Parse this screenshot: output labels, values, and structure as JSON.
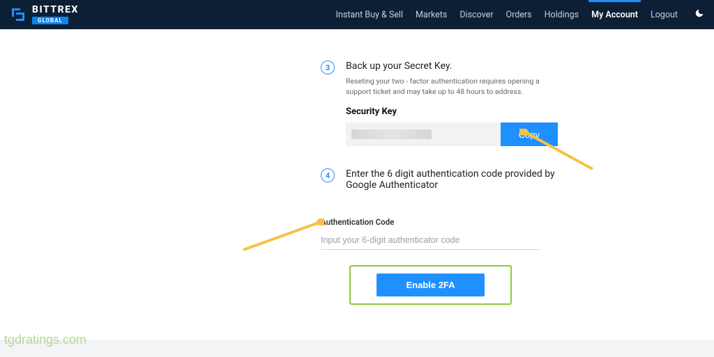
{
  "brand": {
    "name": "BITTREX",
    "tag": "GLOBAL"
  },
  "nav": {
    "items": [
      {
        "label": "Instant Buy & Sell",
        "active": false
      },
      {
        "label": "Markets",
        "active": false
      },
      {
        "label": "Discover",
        "active": false
      },
      {
        "label": "Orders",
        "active": false
      },
      {
        "label": "Holdings",
        "active": false
      },
      {
        "label": "My Account",
        "active": true
      },
      {
        "label": "Logout",
        "active": false
      }
    ]
  },
  "step3": {
    "num": "3",
    "title": "Back up your Secret Key.",
    "note": "Reseting your two - factor authentication requires opening a support ticket and may take up to 48 hours to address.",
    "keyLabel": "Security Key",
    "copy": "Copy"
  },
  "step4": {
    "num": "4",
    "title": "Enter the 6 digit authentication code provided by Google Authenticator"
  },
  "auth": {
    "label": "Authentication Code",
    "placeholder": "Input your 6-digit authenticator code"
  },
  "enable": {
    "label": "Enable 2FA"
  },
  "watermark": "tgdratings.com"
}
